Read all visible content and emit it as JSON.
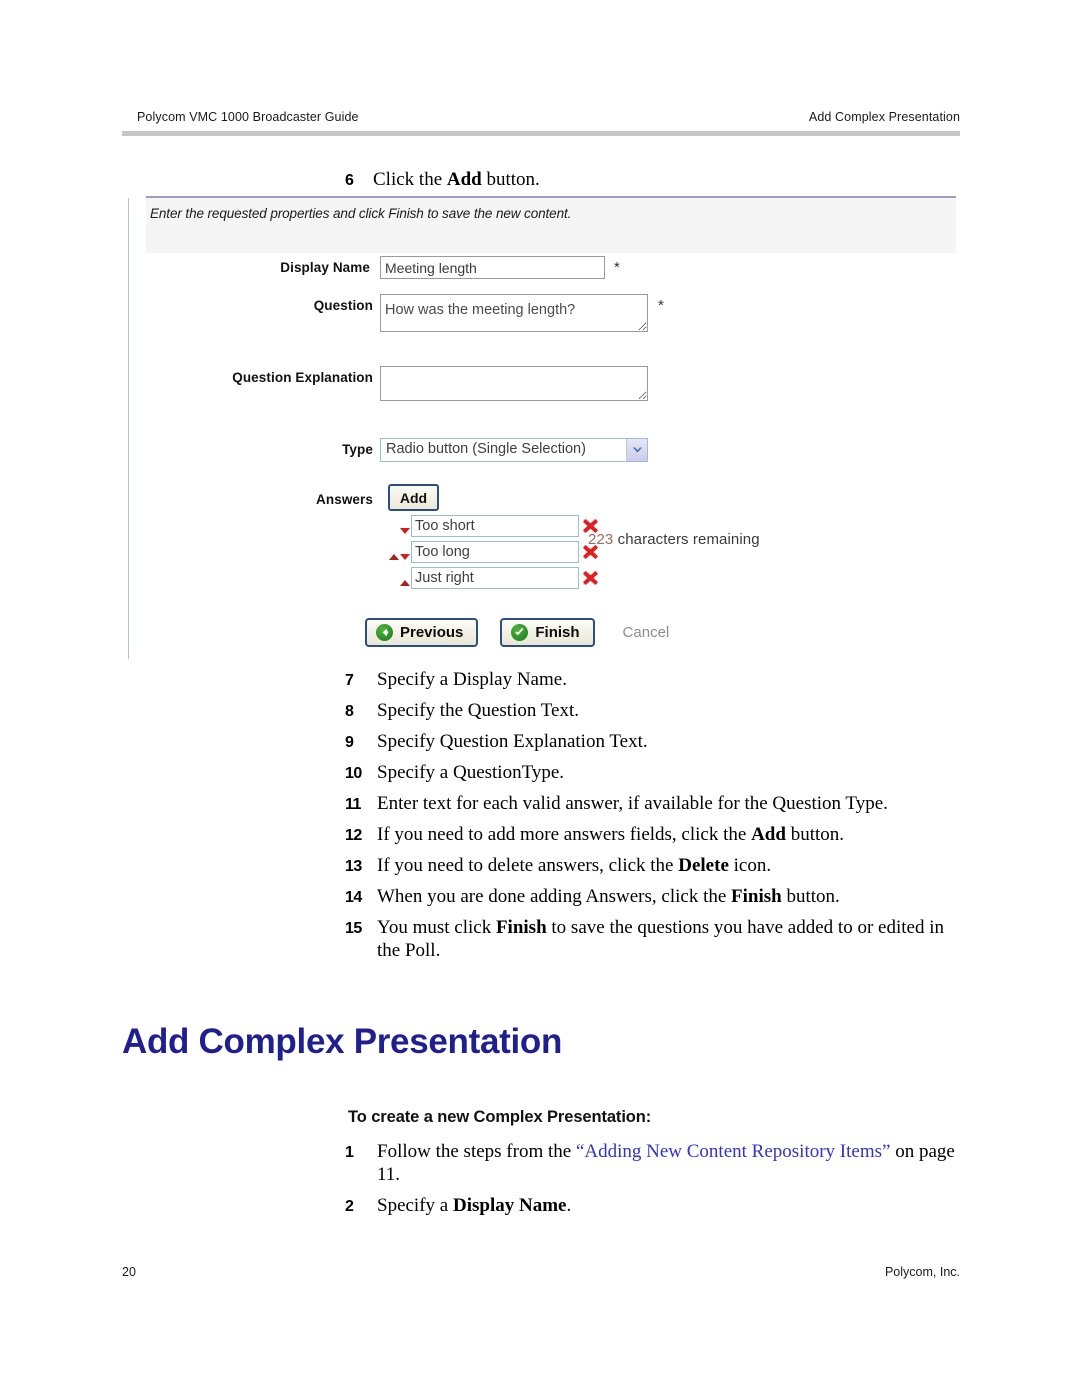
{
  "header": {
    "left": "Polycom VMC 1000 Broadcaster Guide",
    "right": "Add Complex Presentation"
  },
  "step6": {
    "number": "6",
    "text_before": "Click the ",
    "bold": "Add",
    "text_after": " button."
  },
  "screenshot": {
    "instruction": "Enter the requested properties and click Finish to save the new content.",
    "fields": {
      "display_name": {
        "label": "Display Name",
        "value": "Meeting length",
        "required_marker": "*"
      },
      "question": {
        "label": "Question",
        "value": "How was the meeting length?",
        "required_marker": "*",
        "chars_count": "223",
        "chars_label": "characters remaining"
      },
      "question_explanation": {
        "label": "Question Explanation",
        "value": ""
      },
      "type": {
        "label": "Type",
        "selected": "Radio button (Single Selection)"
      },
      "answers": {
        "label": "Answers",
        "add_label": "Add",
        "items": [
          {
            "value": "Too short",
            "up": false,
            "down": true
          },
          {
            "value": "Too long",
            "up": true,
            "down": true
          },
          {
            "value": "Just right",
            "up": true,
            "down": false
          }
        ]
      }
    },
    "buttons": {
      "previous": "Previous",
      "finish": "Finish",
      "cancel": "Cancel"
    }
  },
  "steps_main": [
    {
      "num": "7",
      "text": "Specify a Display Name."
    },
    {
      "num": "8",
      "text": "Specify the Question Text."
    },
    {
      "num": "9",
      "text": "Specify Question Explanation Text."
    },
    {
      "num": "10",
      "text": "Specify a QuestionType."
    },
    {
      "num": "11",
      "text": "Enter text for each valid answer, if available for the Question Type."
    },
    {
      "num": "12",
      "text_before": "If you need to add more answers fields, click the ",
      "bold": "Add",
      "text_after": " button."
    },
    {
      "num": "13",
      "text_before": "If you need to delete answers, click the ",
      "bold": "Delete",
      "text_after": " icon."
    },
    {
      "num": "14",
      "text_before": "When you are done adding Answers, click the ",
      "bold": "Finish",
      "text_after": " button."
    },
    {
      "num": "15",
      "text_before": "You must click ",
      "bold": "Finish",
      "text_after": " to save the questions you have added to or edited in the Poll."
    }
  ],
  "section": {
    "heading": "Add Complex Presentation",
    "subheading": "To create a new Complex Presentation:"
  },
  "steps_last": [
    {
      "num": "1",
      "text_before": "Follow the steps from the ",
      "link": "“Adding New Content Repository Items”",
      "text_after": " on page 11."
    },
    {
      "num": "2",
      "text_before": "Specify a ",
      "bold": "Display Name",
      "text_after": "."
    }
  ],
  "footer": {
    "page_number": "20",
    "company": "Polycom, Inc."
  },
  "colors": {
    "heading_blue": "#1f1f8f",
    "xref_blue": "#3232c8",
    "delete_red": "#e02020",
    "icon_green": "#1d7a1d"
  }
}
